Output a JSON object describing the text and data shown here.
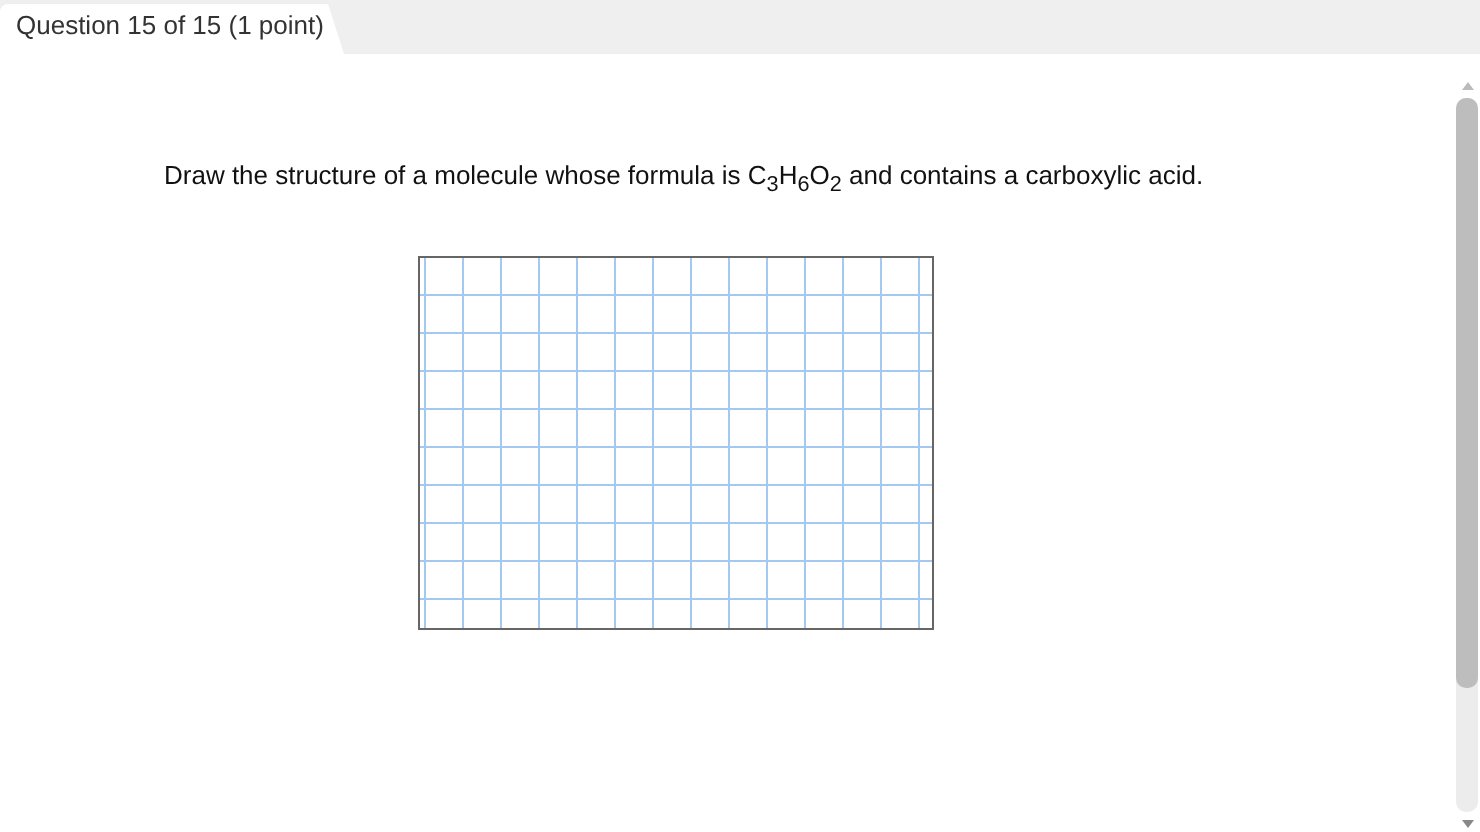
{
  "tab": {
    "label": "Question 15 of 15 (1 point)"
  },
  "question": {
    "text": "Draw the structure of a molecule whose formula is C$_{3}$H$_{6}$O$_{2}$ and contains a carboxylic acid."
  }
}
